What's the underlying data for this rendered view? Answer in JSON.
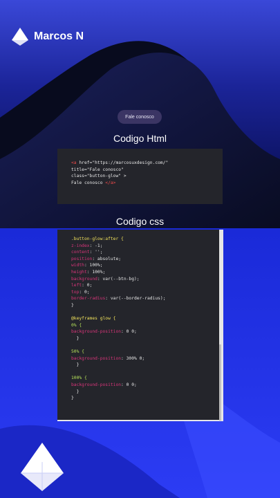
{
  "brand": {
    "name": "Marcos N",
    "logo_icon": "triangle-star-logo-icon"
  },
  "button_demo": {
    "label": "Fale conosco"
  },
  "sections": {
    "html_title": "Codigo Html",
    "css_title": "Codigo css"
  },
  "html_code": {
    "line1_open": "<a",
    "line1_rest": " href=\"https://marcosuxdesign.com/\"",
    "line2": "title=\"Fale conosco\"",
    "line3": "class=\"button-glow\" >",
    "line4_text": "Fale conosco ",
    "line4_close": "</a>"
  },
  "css_code": {
    "selector": ".button-glow:after {",
    "props": [
      {
        "name": "z-index",
        "value": " -1;"
      },
      {
        "name": "content",
        "value": " '';"
      },
      {
        "name": "position",
        "value": " absolute;"
      },
      {
        "name": "width",
        "value": " 100%;"
      },
      {
        "name": "height",
        "value": " 100%;"
      },
      {
        "name": "background",
        "value": " var(--btn-bg);"
      },
      {
        "name": "left",
        "value": " 0;"
      },
      {
        "name": "top",
        "value": " 0;"
      },
      {
        "name": "border-radius",
        "value": " var(--border-radius);"
      }
    ],
    "close1": "}",
    "keyframes": "@keyframes glow {",
    "k0": "0% {",
    "k0_prop": "background-position",
    "k0_val": ": 0 0;",
    "k50": "50% {",
    "k50_prop": "background-position",
    "k50_val": ": 300% 0;",
    "k100": "100% {",
    "k100_prop": "background-position",
    "k100_val": ": 0 0;",
    "inner_close": "  }",
    "close2": "}"
  },
  "colors": {
    "accent_blue": "#2a3ef0",
    "code_bg": "#24252b",
    "pill_bg": "#3b3564"
  }
}
